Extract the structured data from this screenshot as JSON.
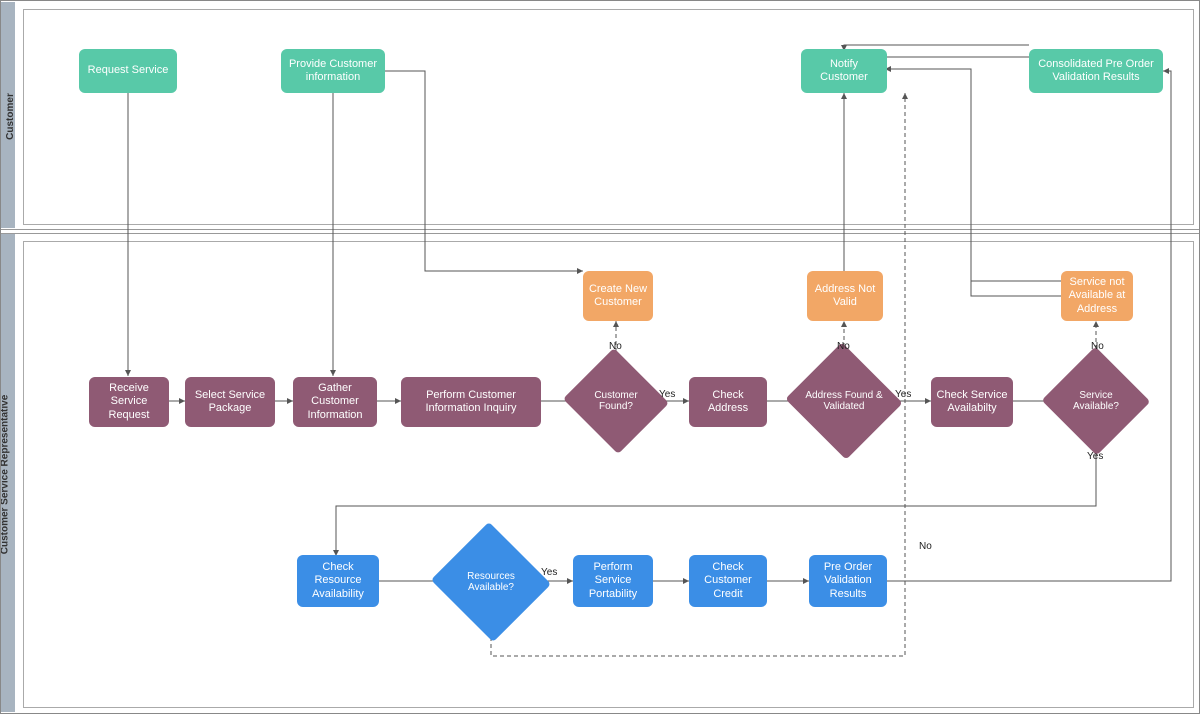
{
  "lanes": {
    "customer": "Customer",
    "csr": "Customer Service Representative"
  },
  "nodes": {
    "request_service": "Request Service",
    "provide_info": "Provide Customer information",
    "notify_customer": "Notify Customer",
    "consolidated": "Consolidated Pre Order Validation Results",
    "receive_req": "Receive Service Request",
    "select_pkg": "Select Service Package",
    "gather_info": "Gather Customer Information",
    "perform_inquiry": "Perform Customer Information Inquiry",
    "create_new": "Create New Customer",
    "customer_found": "Customer Found?",
    "check_address": "Check Address",
    "addr_not_valid": "Address Not Valid",
    "addr_found": "Address Found & Validated",
    "check_svc_avail": "Check Service Availabilty",
    "svc_not_avail": "Service not Available at Address",
    "svc_available": "Service Available?",
    "check_resource": "Check Resource Availability",
    "resources_avail": "Resources Available?",
    "perform_port": "Perform Service Portability",
    "check_credit": "Check Customer Credit",
    "preorder_results": "Pre Order Validation Results"
  },
  "labels": {
    "yes": "Yes",
    "no": "No"
  }
}
